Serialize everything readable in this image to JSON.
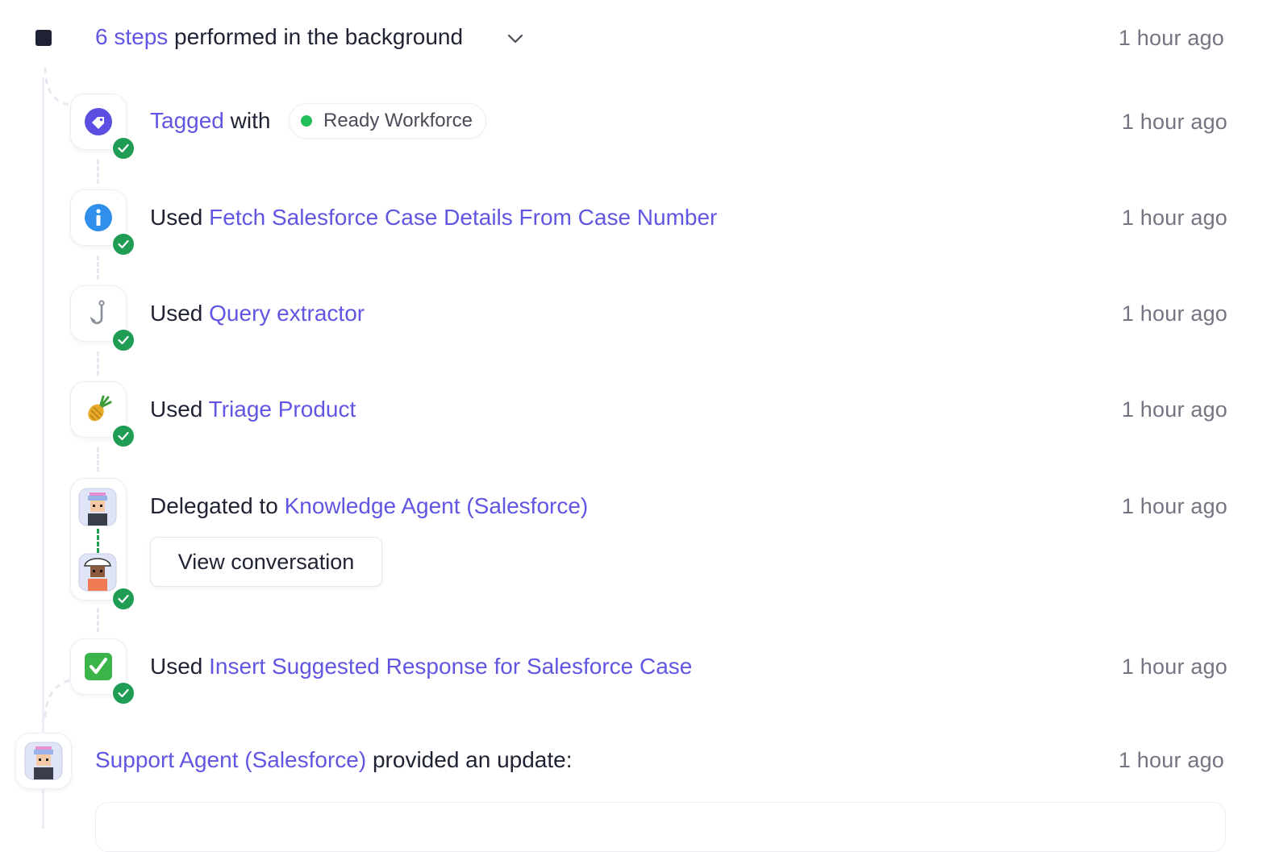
{
  "header": {
    "steps_link": "6 steps",
    "text": " performed in the background",
    "time": "1 hour ago"
  },
  "steps": [
    {
      "verb": "Tagged",
      "middle": " with",
      "tag": "Ready Workforce",
      "tag_color": "#22c05a",
      "icon": "tag-icon",
      "time": "1 hour ago"
    },
    {
      "verb": "Used ",
      "link": "Fetch Salesforce Case Details From Case Number",
      "icon": "info-icon",
      "time": "1 hour ago"
    },
    {
      "verb": "Used ",
      "link": "Query extractor",
      "icon": "hook-icon",
      "time": "1 hour ago"
    },
    {
      "verb": "Used ",
      "link": "Triage Product",
      "icon": "pineapple-icon",
      "time": "1 hour ago"
    },
    {
      "verb": "Delegated to ",
      "link": "Knowledge Agent (Salesforce)",
      "icon": "agent-avatar-icon",
      "time": "1 hour ago",
      "button": "View conversation"
    },
    {
      "verb": "Used ",
      "link": "Insert Suggested Response for Salesforce Case",
      "icon": "checkbox-icon",
      "time": "1 hour ago"
    }
  ],
  "update": {
    "agent": "Support Agent (Salesforce)",
    "text": " provided an update:",
    "time": "1 hour ago"
  },
  "colors": {
    "accent": "#6156e2",
    "success": "#1f9d55",
    "text": "#1f2233",
    "muted": "#737583"
  }
}
